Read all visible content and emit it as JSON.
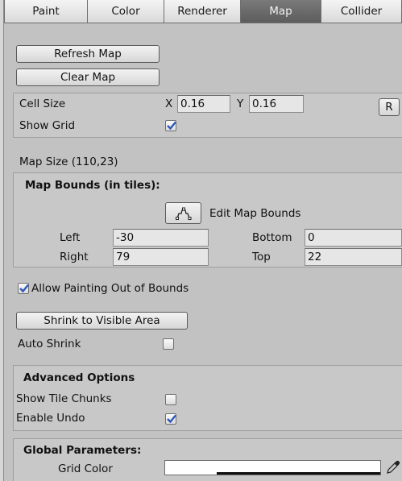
{
  "tabs": [
    {
      "label": "Paint",
      "active": false
    },
    {
      "label": "Color",
      "active": false
    },
    {
      "label": "Renderer",
      "active": false
    },
    {
      "label": "Map",
      "active": true
    },
    {
      "label": "Collider",
      "active": false
    }
  ],
  "buttons": {
    "refresh_map": "Refresh Map",
    "clear_map": "Clear Map",
    "reset": "R",
    "shrink": "Shrink to Visible Area"
  },
  "cell": {
    "label": "Cell Size",
    "x_label": "X",
    "x_value": "0.16",
    "y_label": "Y",
    "y_value": "0.16",
    "show_grid_label": "Show Grid",
    "show_grid": true
  },
  "map_size": "Map Size (110,23)",
  "bounds": {
    "title": "Map Bounds (in tiles):",
    "edit_label": "Edit Map Bounds",
    "left_label": "Left",
    "left_value": "-30",
    "right_label": "Right",
    "right_value": "79",
    "bottom_label": "Bottom",
    "bottom_value": "0",
    "top_label": "Top",
    "top_value": "22"
  },
  "allow_out_of_bounds": {
    "label": "Allow Painting Out of Bounds",
    "checked": true
  },
  "auto_shrink": {
    "label": "Auto Shrink",
    "checked": false
  },
  "advanced": {
    "title": "Advanced Options",
    "show_chunks_label": "Show Tile Chunks",
    "show_chunks": false,
    "undo_label": "Enable Undo",
    "undo": true
  },
  "global": {
    "title": "Global Parameters:",
    "grid_color_label": "Grid Color",
    "grid_color": "#ffffff",
    "grid_alpha": 0.75
  },
  "colors": {
    "panel_bg": "#c2c2c2",
    "active_tab": "#6a6a6a",
    "check_blue": "#2e57b8"
  }
}
